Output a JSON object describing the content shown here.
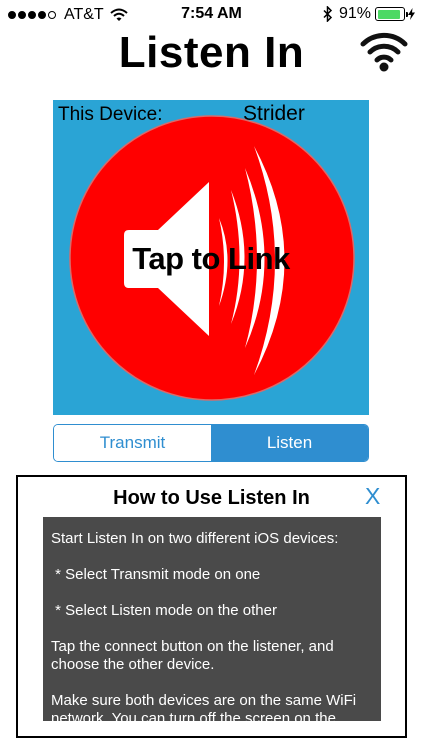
{
  "status_bar": {
    "carrier": "AT&T",
    "time": "7:54 AM",
    "battery_percent": "91%",
    "battery_level": 0.91,
    "signal_bars_filled": 4,
    "signal_bars_total": 5,
    "icons": [
      "wifi-icon",
      "bluetooth-icon",
      "battery-icon",
      "charging-bolt-icon"
    ]
  },
  "header": {
    "title": "Listen In",
    "icon": "wifi-logo-icon"
  },
  "link_panel": {
    "device_label": "This Device:",
    "device_name": "Strider",
    "button_label": "Tap to Link",
    "icon": "speaker-icon",
    "colors": {
      "background": "#2aa4d5",
      "circle": "#ff0000",
      "speaker": "#ffffff"
    }
  },
  "mode_control": {
    "options": [
      "Transmit",
      "Listen"
    ],
    "selected": "Listen",
    "accent": "#2f8ed0"
  },
  "help": {
    "title": "How to Use Listen In",
    "close_label": "X",
    "lines": [
      "Start Listen In on two different iOS devices:",
      " * Select Transmit mode on one",
      " * Select Listen mode on the other",
      "Tap the connect button on the listener, and choose the other device.",
      "Make sure both devices are on the same WiFi network. You can turn off the screen on the"
    ]
  }
}
